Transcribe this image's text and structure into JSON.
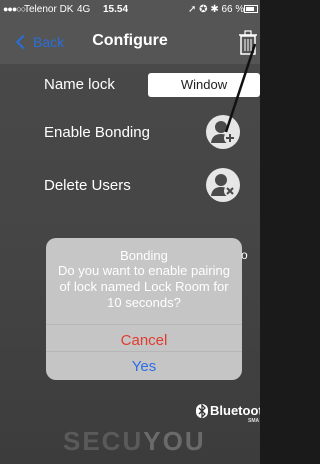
{
  "status_bar": {
    "signal_dots": "●●●○○",
    "carrier": "Telenor DK",
    "network": "4G",
    "time": "15.54",
    "right_status": "➚ ✪ ✱ 66 %"
  },
  "navbar": {
    "back_label": "Back",
    "title": "Configure"
  },
  "rows": {
    "name_lock_label": "Name lock",
    "name_lock_value": "Window",
    "enable_bonding_label": "Enable Bonding",
    "delete_users_label": "Delete Users"
  },
  "dialog": {
    "title": "Bonding",
    "message": "Do you want to enable pairing of lock named Lock Room for 10 seconds?",
    "cancel_label": "Cancel",
    "yes_label": "Yes",
    "edge_fragment": "o"
  },
  "footer": {
    "bluetooth_label": "Bluetooth",
    "bluetooth_sub": "SMA",
    "logo_part1": "SECU",
    "logo_part2": "YOU"
  },
  "colors": {
    "accent_blue": "#2a6fd6",
    "cancel_red": "#e23b2e",
    "dialog_blue": "#2d6ee6"
  }
}
